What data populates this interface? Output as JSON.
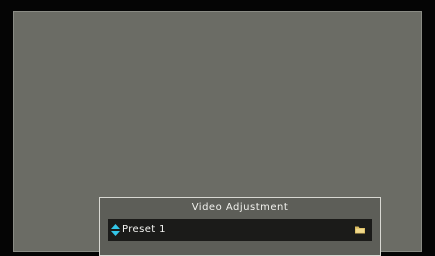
{
  "osd": {
    "title": "Video Adjustment",
    "preset": {
      "value": "Preset 1",
      "left_icon": "up-down-arrows-icon",
      "right_icon": "folder-icon"
    }
  },
  "colors": {
    "screen_background": "#6b6c65",
    "panel_background": "#5d5e58",
    "row_background": "#1b1b19",
    "accent_icon": "#33c6e8",
    "folder_icon": "#e8cc7b"
  }
}
